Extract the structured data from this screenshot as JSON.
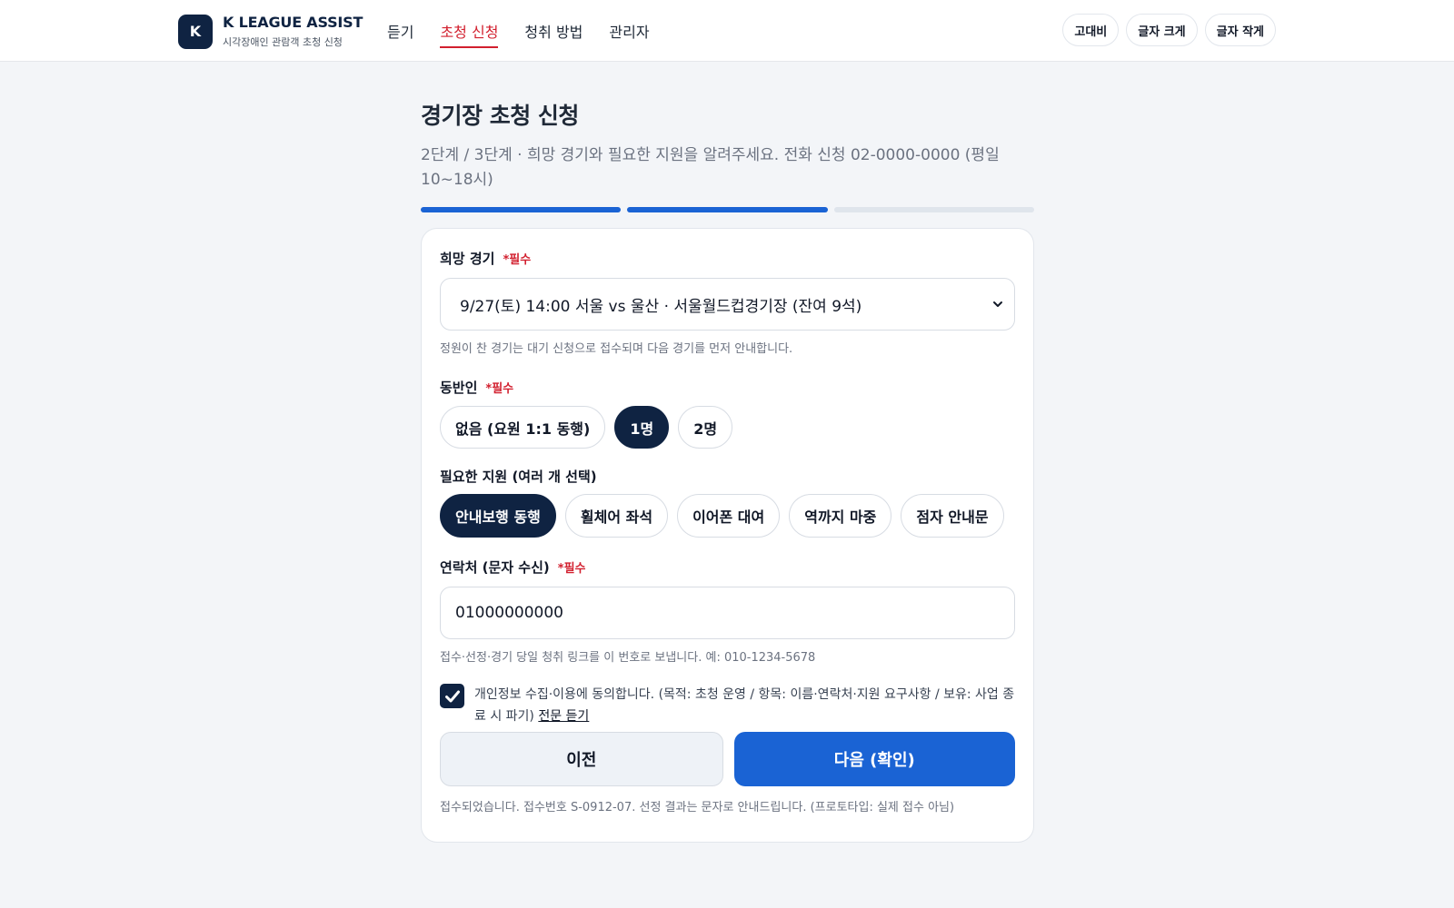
{
  "brand": {
    "logo_letter": "K",
    "title": "K LEAGUE ASSIST",
    "subtitle": "시각장애인 관람객 초청 신청"
  },
  "nav": [
    {
      "label": "듣기",
      "active": false
    },
    {
      "label": "초청 신청",
      "active": true
    },
    {
      "label": "청취 방법",
      "active": false
    },
    {
      "label": "관리자",
      "active": false
    }
  ],
  "tools": {
    "contrast": "고대비",
    "font_up": "글자 크게",
    "font_down": "글자 작게"
  },
  "page": {
    "title": "경기장 초청 신청",
    "subtitle": "2단계 / 3단계 · 희망 경기와 필요한 지원을 알려주세요. 전화 신청 02-0000-0000 (평일 10~18시)",
    "step_current": 2,
    "step_total": 3
  },
  "form": {
    "match": {
      "label": "희망 경기",
      "required_mark": "*필수",
      "selected": "9/27(토) 14:00 서울 vs 울산 · 서울월드컵경기장 (잔여 9석)",
      "hint": "정원이 찬 경기는 대기 신청으로 접수되며 다음 경기를 먼저 안내합니다."
    },
    "companion": {
      "label": "동반인",
      "required_mark": "*필수",
      "options": [
        "없음 (요원 1:1 동행)",
        "1명",
        "2명"
      ],
      "selected_index": 1
    },
    "support": {
      "label": "필요한 지원 (여러 개 선택)",
      "options": [
        "안내보행 동행",
        "휠체어 좌석",
        "이어폰 대여",
        "역까지 마중",
        "점자 안내문"
      ],
      "selected": [
        true,
        false,
        false,
        false,
        false
      ]
    },
    "contact": {
      "label": "연락처 (문자 수신)",
      "required_mark": "*필수",
      "value": "01000000000",
      "hint": "접수·선정·경기 당일 청취 링크를 이 번호로 보냅니다. 예: 010-1234-5678"
    },
    "consent": {
      "checked": true,
      "text": "개인정보 수집·이용에 동의합니다. (목적: 초청 운영 / 항목: 이름·연락처·지원 요구사항 / 보유: 사업 종료 시 파기) ",
      "link": "전문 듣기"
    },
    "buttons": {
      "prev": "이전",
      "next": "다음 (확인)"
    },
    "status": "접수되었습니다. 접수번호 S-0912-07. 선정 결과는 문자로 안내드립니다. (프로토타입: 실제 접수 아님)"
  },
  "colors": {
    "brand_navy": "#0f2342",
    "accent_red": "#d21f2e",
    "primary_blue": "#1a63d4"
  }
}
